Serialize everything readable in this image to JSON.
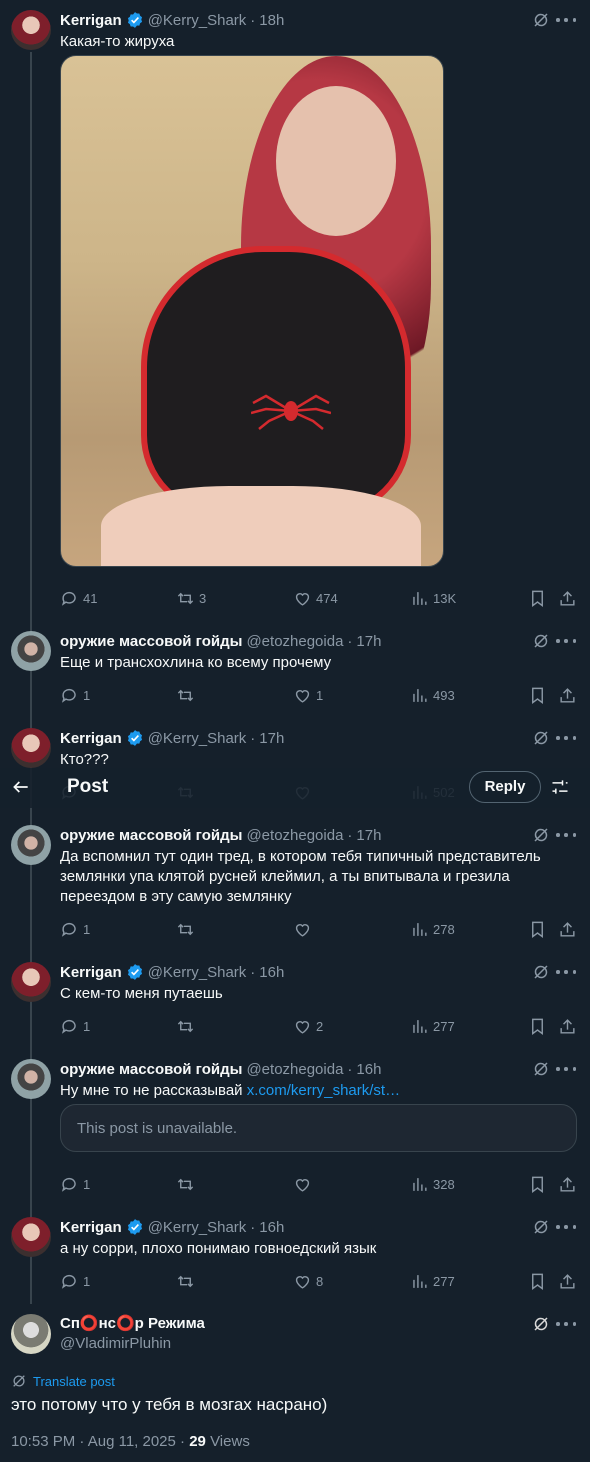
{
  "colors": {
    "background": "#15202b",
    "accent": "#1d9bf0",
    "muted": "#8b98a5"
  },
  "topbar": {
    "title": "Post",
    "reply_label": "Reply"
  },
  "posts": [
    {
      "name": "Kerrigan",
      "verified": true,
      "handle": "@Kerry_Shark",
      "time": "18h",
      "text": "Какая-то жируха",
      "stats": {
        "replies": "41",
        "reposts": "3",
        "likes": "474",
        "views": "13K"
      }
    },
    {
      "name": "оружие массовой гойды",
      "handle": "@etozhegoida",
      "time": "17h",
      "text": "Еще и трансхохлина ко всему прочему",
      "stats": {
        "replies": "1",
        "reposts": "",
        "likes": "1",
        "views": "493"
      }
    },
    {
      "name": "Kerrigan",
      "verified": true,
      "handle": "@Kerry_Shark",
      "time": "17h",
      "text": "Кто???",
      "stats": {
        "replies": "",
        "reposts": "",
        "likes": "",
        "views": "502"
      }
    },
    {
      "name": "оружие массовой гойды",
      "handle": "@etozhegoida",
      "time": "17h",
      "text": "Да вспомнил тут один тред, в котором тебя типичный представитель землянки упа клятой русней клеймил, а ты впитывала и грезила переездом в эту самую землянку",
      "stats": {
        "replies": "1",
        "reposts": "",
        "likes": "",
        "views": "278"
      }
    },
    {
      "name": "Kerrigan",
      "verified": true,
      "handle": "@Kerry_Shark",
      "time": "16h",
      "text": "С кем-то меня путаешь",
      "stats": {
        "replies": "1",
        "reposts": "",
        "likes": "2",
        "views": "277"
      }
    },
    {
      "name": "оружие массовой гойды",
      "handle": "@etozhegoida",
      "time": "16h",
      "text": "Ну мне то не рассказывай ",
      "link": "x.com/kerry_shark/st…",
      "quote": "This post is unavailable.",
      "stats": {
        "replies": "1",
        "reposts": "",
        "likes": "",
        "views": "328"
      }
    },
    {
      "name": "Kerrigan",
      "verified": true,
      "handle": "@Kerry_Shark",
      "time": "16h",
      "text": "а ну сорри, плохо понимаю говноедский язык",
      "stats": {
        "replies": "1",
        "reposts": "",
        "likes": "8",
        "views": "277"
      }
    }
  ],
  "main_post": {
    "name": "Сп⭕нс⭕р Режима",
    "handle": "@VladimirPluhin",
    "translate": "Translate post",
    "text": "это потому что у тебя в мозгах насрано)",
    "time": "10:53 PM",
    "date": "Aug 11, 2025",
    "views_count": "29",
    "views_label": "Views"
  }
}
